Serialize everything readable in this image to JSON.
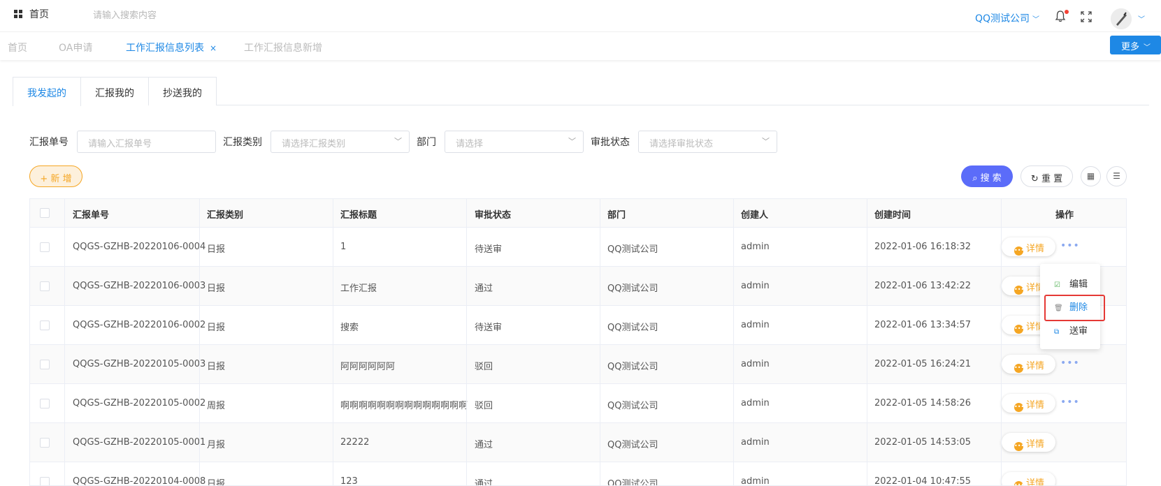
{
  "topbar": {
    "home_label": "首页",
    "search_placeholder": "请输入搜索内容",
    "company": "QQ测试公司"
  },
  "nav_tabs": [
    {
      "label": "首页"
    },
    {
      "label": "OA申请"
    },
    {
      "label": "工作汇报信息列表",
      "close": "×"
    },
    {
      "label": "工作汇报信息新增"
    }
  ],
  "more_label": "更多",
  "sub_tabs": [
    {
      "label": "我发起的"
    },
    {
      "label": "汇报我的"
    },
    {
      "label": "抄送我的"
    }
  ],
  "filters": {
    "report_no_label": "汇报单号",
    "report_no_placeholder": "请输入汇报单号",
    "type_label": "汇报类别",
    "type_placeholder": "请选择汇报类别",
    "dept_label": "部门",
    "dept_placeholder": "请选择",
    "status_label": "审批状态",
    "status_placeholder": "请选择审批状态"
  },
  "toolbar": {
    "add_label": "+ 新 增",
    "search_label": "搜 索",
    "reset_label": "重 置"
  },
  "table": {
    "headers": [
      "汇报单号",
      "汇报类别",
      "汇报标题",
      "审批状态",
      "部门",
      "创建人",
      "创建时间",
      "操作"
    ],
    "rows": [
      {
        "no": "QQGS-GZHB-20220106-0004",
        "type": "日报",
        "title": "1",
        "status": "待送审",
        "dept": "QQ测试公司",
        "creator": "admin",
        "time": "2022-01-06 16:18:32"
      },
      {
        "no": "QQGS-GZHB-20220106-0003",
        "type": "日报",
        "title": "工作汇报",
        "status": "通过",
        "dept": "QQ测试公司",
        "creator": "admin",
        "time": "2022-01-06 13:42:22"
      },
      {
        "no": "QQGS-GZHB-20220106-0002",
        "type": "日报",
        "title": "搜索",
        "status": "待送审",
        "dept": "QQ测试公司",
        "creator": "admin",
        "time": "2022-01-06 13:34:57"
      },
      {
        "no": "QQGS-GZHB-20220105-0003",
        "type": "日报",
        "title": "阿阿阿阿阿阿",
        "status": "驳回",
        "dept": "QQ测试公司",
        "creator": "admin",
        "time": "2022-01-05 16:24:21"
      },
      {
        "no": "QQGS-GZHB-20220105-0002",
        "type": "周报",
        "title": "啊啊啊啊啊啊啊啊啊啊啊啊啊啊",
        "status": "驳回",
        "dept": "QQ测试公司",
        "creator": "admin",
        "time": "2022-01-05 14:58:26"
      },
      {
        "no": "QQGS-GZHB-20220105-0001",
        "type": "月报",
        "title": "22222",
        "status": "通过",
        "dept": "QQ测试公司",
        "creator": "admin",
        "time": "2022-01-05 14:53:05"
      },
      {
        "no": "QQGS-GZHB-20220104-0008",
        "type": "日报",
        "title": "123",
        "status": "通过",
        "dept": "QQ测试公司",
        "creator": "admin",
        "time": "2022-01-04 10:47:55"
      }
    ],
    "detail_label": "详情"
  },
  "action_menu": {
    "edit_label": "编辑",
    "delete_label": "删除",
    "send_label": "送审"
  }
}
